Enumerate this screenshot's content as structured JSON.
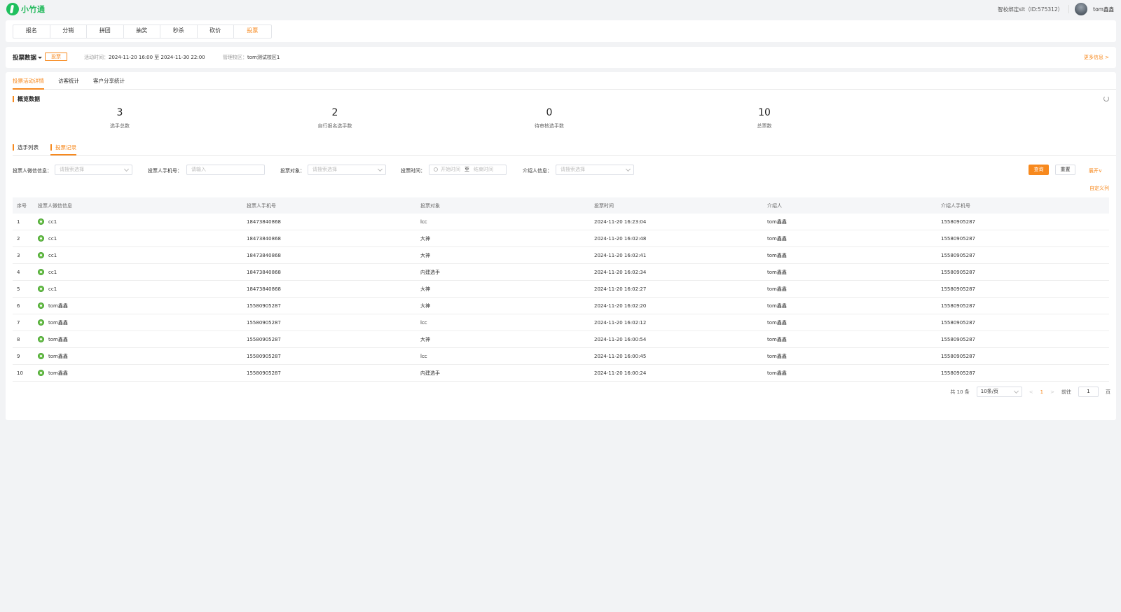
{
  "brand": {
    "name": "小竹通"
  },
  "header": {
    "school": "智校绑定slt（ID:575312）",
    "username": "tom鑫鑫"
  },
  "modules": [
    "报名",
    "分销",
    "拼团",
    "抽奖",
    "秒杀",
    "砍价",
    "投票"
  ],
  "info": {
    "title": "投票数据",
    "tag": "投票",
    "time_label": "活动时间：",
    "time_value": "2024-11-20 16:00 至 2024-11-30 22:00",
    "campus_label": "管理校区：",
    "campus_value": "tom测试校区1",
    "more": "更多信息 >"
  },
  "subtabs": [
    "投票活动详情",
    "访客统计",
    "客户分享统计"
  ],
  "overview": {
    "title": "概览数据",
    "stats": [
      {
        "value": "3",
        "label": "选手总数"
      },
      {
        "value": "2",
        "label": "自行报名选手数"
      },
      {
        "value": "0",
        "label": "待审核选手数"
      },
      {
        "value": "10",
        "label": "总票数"
      }
    ]
  },
  "section_tabs": [
    "选手列表",
    "投票记录"
  ],
  "filters": {
    "wechat_label": "投票人微信信息：",
    "wechat_placeholder": "请搜索选择",
    "phone_label": "投票人手机号：",
    "phone_placeholder": "请输入",
    "target_label": "投票对象：",
    "target_placeholder": "请搜索选择",
    "time_label": "投票时间：",
    "time_start": "开始时间",
    "time_sep": "至",
    "time_end": "结束时间",
    "referrer_label": "介绍人信息：",
    "referrer_placeholder": "请搜索选择",
    "query": "查询",
    "reset": "重置",
    "expand": "展开∨",
    "custom_columns": "自定义列"
  },
  "table": {
    "headers": [
      "序号",
      "投票人微信信息",
      "投票人手机号",
      "投票对象",
      "投票时间",
      "介绍人",
      "介绍人手机号"
    ],
    "rows": [
      [
        "1",
        "cc1",
        "18473840868",
        "lcc",
        "2024-11-20 16:23:04",
        "tom鑫鑫",
        "15580905287"
      ],
      [
        "2",
        "cc1",
        "18473840868",
        "大神",
        "2024-11-20 16:02:48",
        "tom鑫鑫",
        "15580905287"
      ],
      [
        "3",
        "cc1",
        "18473840868",
        "大神",
        "2024-11-20 16:02:41",
        "tom鑫鑫",
        "15580905287"
      ],
      [
        "4",
        "cc1",
        "18473840868",
        "内建选手",
        "2024-11-20 16:02:34",
        "tom鑫鑫",
        "15580905287"
      ],
      [
        "5",
        "cc1",
        "18473840868",
        "大神",
        "2024-11-20 16:02:27",
        "tom鑫鑫",
        "15580905287"
      ],
      [
        "6",
        "tom鑫鑫",
        "15580905287",
        "大神",
        "2024-11-20 16:02:20",
        "tom鑫鑫",
        "15580905287"
      ],
      [
        "7",
        "tom鑫鑫",
        "15580905287",
        "lcc",
        "2024-11-20 16:02:12",
        "tom鑫鑫",
        "15580905287"
      ],
      [
        "8",
        "tom鑫鑫",
        "15580905287",
        "大神",
        "2024-11-20 16:00:54",
        "tom鑫鑫",
        "15580905287"
      ],
      [
        "9",
        "tom鑫鑫",
        "15580905287",
        "lcc",
        "2024-11-20 16:00:45",
        "tom鑫鑫",
        "15580905287"
      ],
      [
        "10",
        "tom鑫鑫",
        "15580905287",
        "内建选手",
        "2024-11-20 16:00:24",
        "tom鑫鑫",
        "15580905287"
      ]
    ]
  },
  "pagination": {
    "total": "共 10 条",
    "page_size": "10条/页",
    "prev": "<",
    "current": "1",
    "next": ">",
    "goto_label": "前往",
    "goto_value": "1",
    "page_suffix": "页"
  },
  "colors": {
    "accent": "#f7891e",
    "brand": "#1fb859",
    "background": "#f2f3f5"
  }
}
